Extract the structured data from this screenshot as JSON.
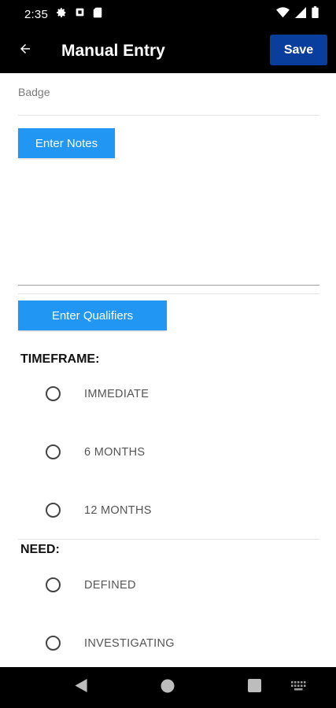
{
  "status_bar": {
    "time": "2:35",
    "left_icons": [
      "gear-icon",
      "shield-notification-icon",
      "sim-card-icon"
    ],
    "right_icons": [
      "wifi-icon",
      "cell-signal-icon",
      "battery-icon"
    ]
  },
  "app_bar": {
    "title": "Manual Entry",
    "back_icon": "arrow-left-icon",
    "save_label": "Save",
    "save_color": "#0a3e9c",
    "background": "#000000"
  },
  "form": {
    "badge_label": "Badge",
    "enter_notes_label": "Enter Notes",
    "enter_qualifiers_label": "Enter Qualifiers",
    "button_color": "#2196f3",
    "sections": [
      {
        "title": "TIMEFRAME:",
        "options": [
          "IMMEDIATE",
          "6 MONTHS",
          "12 MONTHS"
        ]
      },
      {
        "title": "NEED:",
        "options": [
          "DEFINED",
          "INVESTIGATING"
        ]
      }
    ]
  },
  "nav_bar": {
    "items": [
      "back-triangle-icon",
      "home-circle-icon",
      "recents-square-icon",
      "keyboard-icon"
    ]
  }
}
